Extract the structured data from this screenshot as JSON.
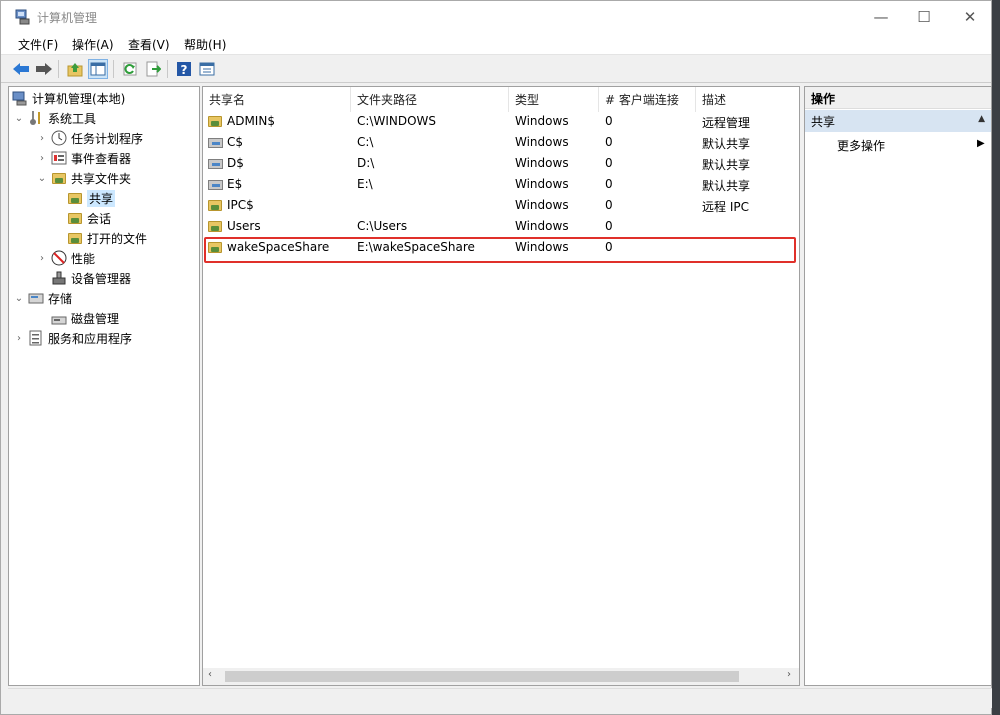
{
  "window": {
    "title": "计算机管理",
    "controls": {
      "minimize": "—",
      "maximize": "☐",
      "close": "✕"
    }
  },
  "menubar": {
    "items": [
      "文件(F)",
      "操作(A)",
      "查看(V)",
      "帮助(H)"
    ]
  },
  "toolbar": {
    "icons": [
      "back-arrow-icon",
      "forward-arrow-icon",
      "up-folder-icon",
      "show-hide-tree-icon",
      "refresh-icon",
      "export-list-icon",
      "help-icon",
      "properties-icon"
    ]
  },
  "tree": {
    "root": "计算机管理(本地)",
    "system_tools": "系统工具",
    "task_scheduler": "任务计划程序",
    "event_viewer": "事件查看器",
    "shared_folders": "共享文件夹",
    "shares": "共享",
    "sessions": "会话",
    "open_files": "打开的文件",
    "performance": "性能",
    "device_manager": "设备管理器",
    "storage": "存储",
    "disk_management": "磁盘管理",
    "services_apps": "服务和应用程序"
  },
  "list": {
    "columns": [
      "共享名",
      "文件夹路径",
      "类型",
      "# 客户端连接",
      "描述"
    ],
    "rows": [
      {
        "name": "ADMIN$",
        "path": "C:\\WINDOWS",
        "type": "Windows",
        "clients": "0",
        "desc": "远程管理",
        "icon": "folder"
      },
      {
        "name": "C$",
        "path": "C:\\",
        "type": "Windows",
        "clients": "0",
        "desc": "默认共享",
        "icon": "drive"
      },
      {
        "name": "D$",
        "path": "D:\\",
        "type": "Windows",
        "clients": "0",
        "desc": "默认共享",
        "icon": "drive"
      },
      {
        "name": "E$",
        "path": "E:\\",
        "type": "Windows",
        "clients": "0",
        "desc": "默认共享",
        "icon": "drive"
      },
      {
        "name": "IPC$",
        "path": "",
        "type": "Windows",
        "clients": "0",
        "desc": "远程 IPC",
        "icon": "folder"
      },
      {
        "name": "Users",
        "path": "C:\\Users",
        "type": "Windows",
        "clients": "0",
        "desc": "",
        "icon": "folder"
      },
      {
        "name": "wakeSpaceShare",
        "path": "E:\\wakeSpaceShare",
        "type": "Windows",
        "clients": "0",
        "desc": "",
        "icon": "folder"
      }
    ]
  },
  "actions": {
    "header": "操作",
    "section": "共享",
    "more": "更多操作"
  }
}
